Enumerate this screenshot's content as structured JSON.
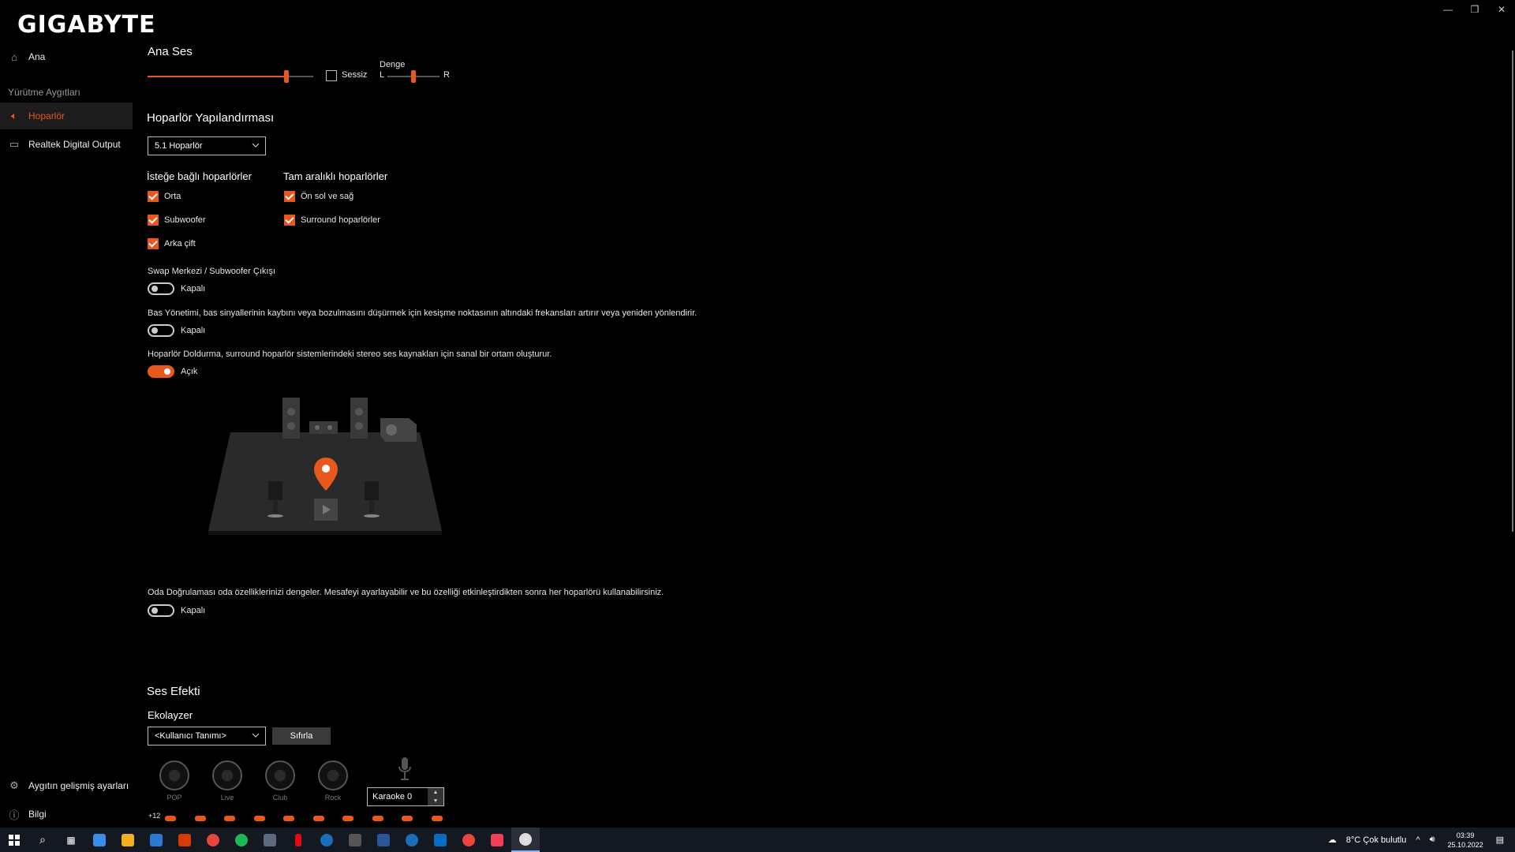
{
  "brand": "GIGABYTE",
  "window": {
    "minimize": "—",
    "restore": "❐",
    "close": "✕"
  },
  "sidebar": {
    "home": "Ana",
    "heading": "Yürütme Aygıtları",
    "items": [
      {
        "label": "Hoparlör"
      },
      {
        "label": "Realtek Digital Output"
      }
    ],
    "advanced": "Aygıtın gelişmiş ayarları",
    "info": "Bilgi"
  },
  "master": {
    "title": "Ana Ses",
    "volume_level": 0.84,
    "mute_label": "Sessiz",
    "balance_label": "Denge",
    "balance_left": "L",
    "balance_right": "R",
    "balance_level": 0.5
  },
  "speaker_config": {
    "title": "Hoparlör Yapılandırması",
    "selected": "5.1 Hoparlör",
    "optional_title": "İsteğe bağlı hoparlörler",
    "fullrange_title": "Tam aralıklı hoparlörler",
    "optional": [
      {
        "label": "Orta",
        "checked": true
      },
      {
        "label": "Subwoofer",
        "checked": true
      },
      {
        "label": "Arka çift",
        "checked": true
      }
    ],
    "fullrange": [
      {
        "label": "Ön sol ve sağ",
        "checked": true
      },
      {
        "label": "Surround hoparlörler",
        "checked": true
      }
    ]
  },
  "swap": {
    "title": "Swap Merkezi / Subwoofer Çıkışı",
    "state": "Kapalı"
  },
  "bass": {
    "title": "Bas Yönetimi, bas sinyallerinin kaybını veya bozulmasını düşürmek için kesişme noktasının altındaki frekansları artırır veya yeniden yönlendirir.",
    "state": "Kapalı"
  },
  "fill": {
    "title": "Hoparlör Doldurma, surround hoparlör sistemlerindeki stereo ses kaynakları için sanal bir ortam oluşturur.",
    "state": "Açık"
  },
  "room": {
    "title": "Oda Doğrulaması oda özelliklerinizi dengeler. Mesafeyi ayarlayabilir ve bu özelliği etkinleştirdikten sonra her hoparlörü kullanabilirsiniz.",
    "state": "Kapalı"
  },
  "effects": {
    "title": "Ses Efekti",
    "eq_title": "Ekolayzer",
    "eq_selected": "<Kullanıcı Tanımı>",
    "reset": "Sıfırla",
    "presets": [
      "POP",
      "Live",
      "Club",
      "Rock"
    ],
    "karaoke": "Karaoke 0",
    "eq_scale_top": "+12"
  },
  "taskbar": {
    "weather": "8°C  Çok bulutlu",
    "time": "03:39",
    "date": "25.10.2022"
  },
  "colors": {
    "accent": "#e8581c",
    "background": "#000000"
  }
}
